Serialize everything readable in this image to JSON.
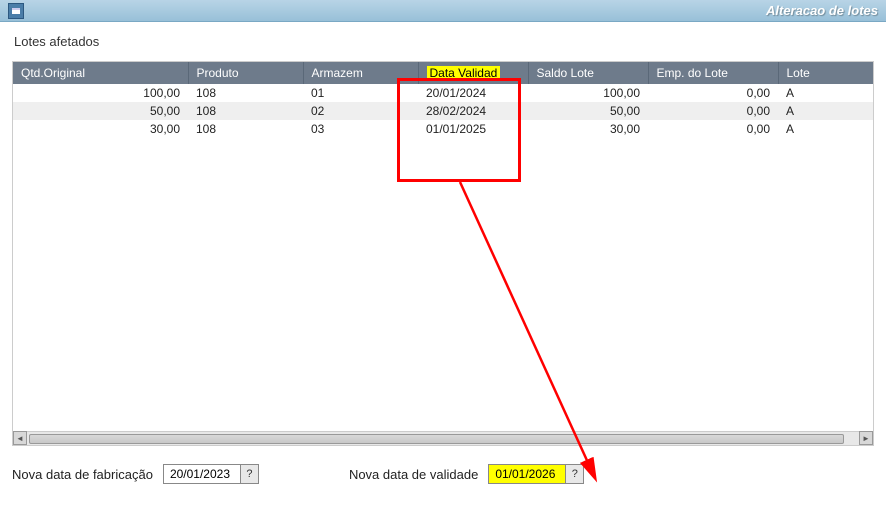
{
  "window": {
    "title": "Alteracao de lotes",
    "section_title": "Lotes afetados"
  },
  "table": {
    "columns": {
      "qtd_original": "Qtd.Original",
      "produto": "Produto",
      "armazem": "Armazem",
      "data_validad": "Data Validad",
      "saldo_lote": "Saldo Lote",
      "emp_do_lote": "Emp. do Lote",
      "lote": "Lote"
    },
    "rows": [
      {
        "qtd_original": "100,00",
        "produto": "108",
        "armazem": "01",
        "data_validad": "20/01/2024",
        "saldo_lote": "100,00",
        "emp_do_lote": "0,00",
        "lote": "A"
      },
      {
        "qtd_original": "50,00",
        "produto": "108",
        "armazem": "02",
        "data_validad": "28/02/2024",
        "saldo_lote": "50,00",
        "emp_do_lote": "0,00",
        "lote": "A"
      },
      {
        "qtd_original": "30,00",
        "produto": "108",
        "armazem": "03",
        "data_validad": "01/01/2025",
        "saldo_lote": "30,00",
        "emp_do_lote": "0,00",
        "lote": "A"
      }
    ]
  },
  "bottom": {
    "fabricacao_label": "Nova data de fabricação",
    "fabricacao_value": "20/01/2023",
    "validade_label": "Nova data de validade",
    "validade_value": "01/01/2026",
    "lookup_symbol": "?"
  }
}
